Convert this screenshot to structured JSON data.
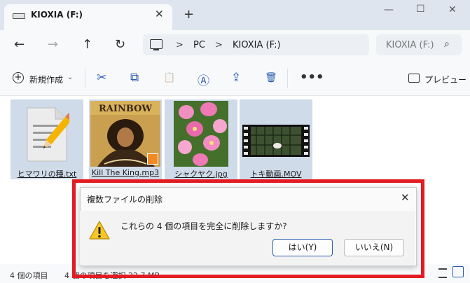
{
  "tab": {
    "title": "KIOXIA (F:)",
    "close_glyph": "✕",
    "add_glyph": "+"
  },
  "window": {
    "minimize_glyph": "—",
    "maximize_glyph": "☐",
    "close_glyph": "✕"
  },
  "nav": {
    "back_glyph": "←",
    "forward_glyph": "→",
    "up_glyph": "↑",
    "refresh_glyph": "↻"
  },
  "address": {
    "crumbs": [
      "PC",
      "KIOXIA (F:)"
    ],
    "separator": ">"
  },
  "search": {
    "placeholder": "KIOXIA (F:)"
  },
  "command_bar": {
    "new_label": "新規作成",
    "new_chevron": "⌄",
    "cut_glyph": "✂",
    "copy_glyph": "⧉",
    "paste_glyph": "📋",
    "rename_glyph": "Ⓐ",
    "share_glyph": "⇪",
    "delete_glyph": "🗑",
    "more_glyph": "•••",
    "preview_label": "プレビュー"
  },
  "files": [
    {
      "name": "ヒマワリの種.txt",
      "icon": "text-file-icon"
    },
    {
      "name": "Kill The King.mp3",
      "icon": "album-art-thumbnail",
      "album_text": "RAINBOW"
    },
    {
      "name": "シャクヤク.jpg",
      "icon": "photo-thumbnail"
    },
    {
      "name": "トキ動画.MOV",
      "icon": "video-thumbnail"
    }
  ],
  "status": {
    "count": "4 個の項目",
    "selected": "4 個の項目を選択  22.7 MB"
  },
  "dialog": {
    "title": "複数ファイルの削除",
    "close_glyph": "✕",
    "message": "これらの 4 個の項目を完全に削除しますか?",
    "yes_label": "はい(Y)",
    "no_label": "いいえ(N)"
  },
  "colors": {
    "accent": "#2a5db0",
    "highlight_frame": "#e31b23",
    "selection": "#cfdbe9"
  }
}
